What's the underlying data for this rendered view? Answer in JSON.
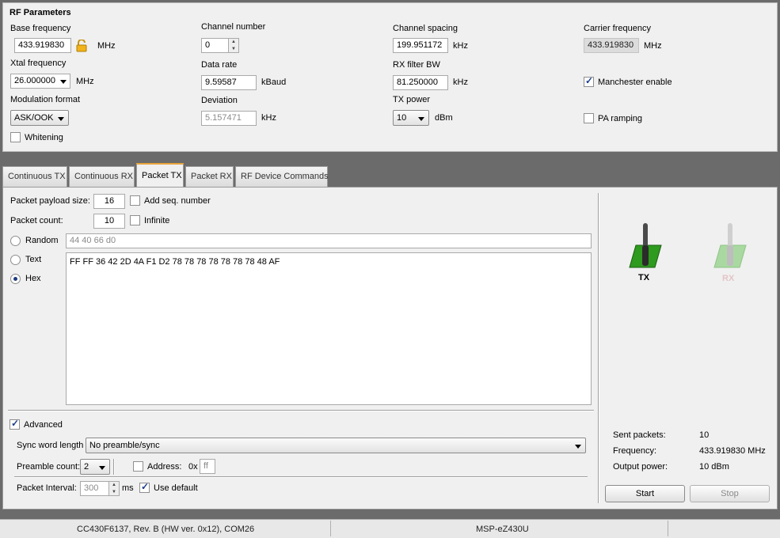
{
  "rf": {
    "title": "RF Parameters",
    "base_freq_label": "Base frequency",
    "base_freq_value": "433.919830",
    "base_freq_unit": "MHz",
    "channel_number_label": "Channel number",
    "channel_number_value": "0",
    "channel_spacing_label": "Channel spacing",
    "channel_spacing_value": "199.951172",
    "channel_spacing_unit": "kHz",
    "carrier_freq_label": "Carrier frequency",
    "carrier_freq_value": "433.919830",
    "carrier_freq_unit": "MHz",
    "xtal_label": "Xtal frequency",
    "xtal_value": "26.000000",
    "xtal_unit": "MHz",
    "data_rate_label": "Data rate",
    "data_rate_value": "9.59587",
    "data_rate_unit": "kBaud",
    "rx_filter_label": "RX filter BW",
    "rx_filter_value": "81.250000",
    "rx_filter_unit": "kHz",
    "manchester_label": "Manchester enable",
    "modulation_label": "Modulation format",
    "modulation_value": "ASK/OOK",
    "deviation_label": "Deviation",
    "deviation_value": "5.157471",
    "deviation_unit": "kHz",
    "tx_power_label": "TX power",
    "tx_power_value": "10",
    "tx_power_unit": "dBm",
    "pa_ramping_label": "PA ramping",
    "whitening_label": "Whitening"
  },
  "tabs": [
    "Continuous TX",
    "Continuous RX",
    "Packet TX",
    "Packet RX",
    "RF Device Commands"
  ],
  "packet": {
    "payload_size_label": "Packet payload size:",
    "payload_size_value": "16",
    "add_seq_label": "Add seq. number",
    "count_label": "Packet count:",
    "count_value": "10",
    "infinite_label": "Infinite",
    "random_label": "Random",
    "random_value": "44 40 66 d0",
    "text_label": "Text",
    "hex_label": "Hex",
    "hex_value": "FF FF 36 42 2D 4A F1 D2 78 78 78 78 78 78 78 48 AF",
    "advanced_label": "Advanced",
    "sync_label": "Sync word length",
    "sync_value": "No preamble/sync",
    "preamble_label": "Preamble count:",
    "preamble_value": "2",
    "address_label": "Address:",
    "address_prefix": "0x",
    "address_value": "ff",
    "interval_label": "Packet Interval:",
    "interval_value": "300",
    "interval_unit": "ms",
    "use_default_label": "Use default"
  },
  "right": {
    "tx_label": "TX",
    "rx_label": "RX",
    "sent_label": "Sent packets:",
    "sent_value": "10",
    "freq_label": "Frequency:",
    "freq_value": "433.919830 MHz",
    "power_label": "Output power:",
    "power_value": "10 dBm",
    "start_label": "Start",
    "stop_label": "Stop"
  },
  "status": {
    "device": "CC430F6137, Rev. B (HW ver. 0x12), COM26",
    "board": "MSP-eZ430U"
  },
  "colors": {
    "tx_green": "#2e9a1e",
    "rx_green": "#a9d9a0",
    "accent_tab": "#e8a33c"
  }
}
